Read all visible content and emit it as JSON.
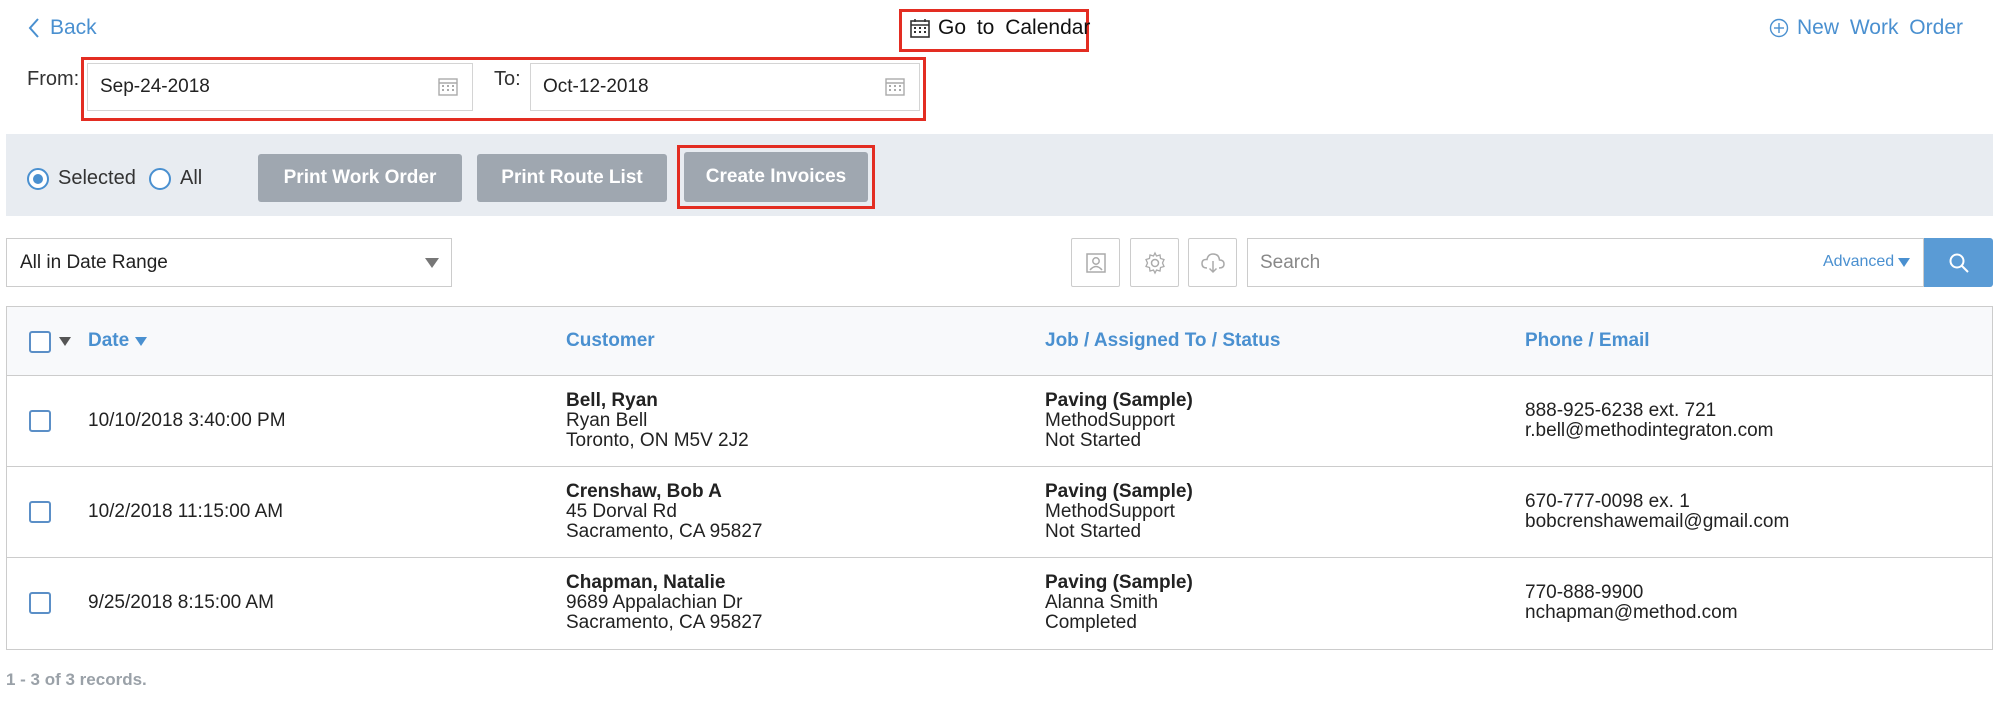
{
  "header": {
    "back_label": "Back",
    "calendar_label": "Go to Calendar",
    "new_work_order_label": "New Work Order"
  },
  "date_range": {
    "from_label": "From:",
    "from_value": "Sep-24-2018",
    "to_label": "To:",
    "to_value": "Oct-12-2018"
  },
  "actions": {
    "radio_selected_label": "Selected",
    "radio_all_label": "All",
    "selected_option": "Selected",
    "print_work_order_label": "Print Work Order",
    "print_route_list_label": "Print Route List",
    "create_invoices_label": "Create Invoices"
  },
  "filter": {
    "range_value": "All in Date Range",
    "search_placeholder": "Search",
    "advanced_label": "Advanced"
  },
  "table": {
    "columns": [
      "Date",
      "Customer",
      "Job / Assigned To / Status",
      "Phone / Email"
    ],
    "rows": [
      {
        "date": "10/10/2018 3:40:00 PM",
        "customer_name": "Bell, Ryan",
        "customer_line2": "Ryan Bell",
        "customer_line3": "Toronto, ON M5V 2J2",
        "job": "Paving (Sample)",
        "assigned_to": "MethodSupport",
        "status": "Not Started",
        "phone": "888-925-6238 ext. 721",
        "email": "r.bell@methodintegraton.com"
      },
      {
        "date": "10/2/2018 11:15:00 AM",
        "customer_name": "Crenshaw, Bob A",
        "customer_line2": "45 Dorval Rd",
        "customer_line3": "Sacramento, CA 95827",
        "job": "Paving (Sample)",
        "assigned_to": "MethodSupport",
        "status": "Not Started",
        "phone": "670-777-0098 ex. 1",
        "email": "bobcrenshawemail@gmail.com"
      },
      {
        "date": "9/25/2018 8:15:00 AM",
        "customer_name": "Chapman, Natalie",
        "customer_line2": "9689 Appalachian Dr",
        "customer_line3": "Sacramento, CA 95827",
        "job": "Paving (Sample)",
        "assigned_to": "Alanna Smith",
        "status": "Completed",
        "phone": "770-888-9900",
        "email": "nchapman@method.com"
      }
    ]
  },
  "footer": {
    "records_text": "1 - 3 of 3 records."
  },
  "colors": {
    "accent": "#4a90d0",
    "highlight": "#e32d22",
    "button_gray": "#9fa7b0",
    "band_bg": "#e8ecf1"
  }
}
